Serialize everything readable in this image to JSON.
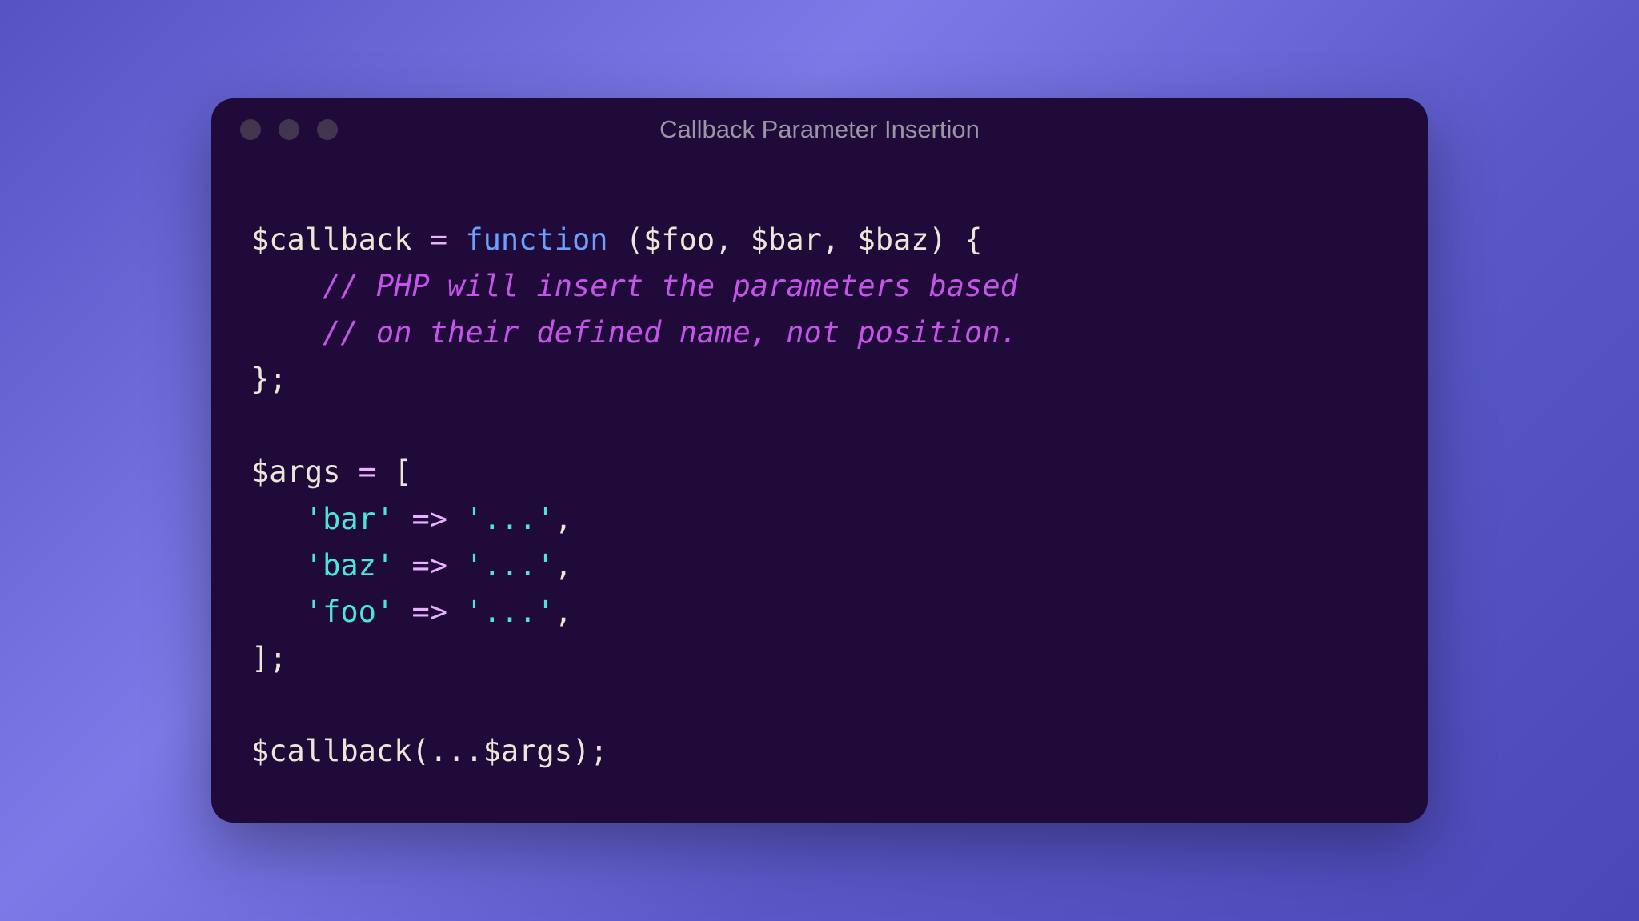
{
  "window": {
    "title": "Callback Parameter Insertion"
  },
  "code": {
    "line1": {
      "var1": "$callback",
      "assign": " = ",
      "keyword": "function",
      "space": " ",
      "open": "(",
      "p1": "$foo",
      "c1": ", ",
      "p2": "$bar",
      "c2": ", ",
      "p3": "$baz",
      "close": ")",
      "brace": " {"
    },
    "line2": {
      "indent": "    ",
      "comment": "// PHP will insert the parameters based"
    },
    "line3": {
      "indent": "    ",
      "comment": "// on their defined name, not position."
    },
    "line4": {
      "close": "};"
    },
    "line6": {
      "var1": "$args",
      "assign": " = ",
      "open": "["
    },
    "line7": {
      "indent": "   ",
      "key": "'bar'",
      "arrow": " => ",
      "val": "'...'",
      "comma": ","
    },
    "line8": {
      "indent": "   ",
      "key": "'baz'",
      "arrow": " => ",
      "val": "'...'",
      "comma": ","
    },
    "line9": {
      "indent": "   ",
      "key": "'foo'",
      "arrow": " => ",
      "val": "'...'",
      "comma": ","
    },
    "line10": {
      "close": "];"
    },
    "line12": {
      "var1": "$callback",
      "open": "(",
      "spread": "...",
      "var2": "$args",
      "close": ");"
    }
  }
}
